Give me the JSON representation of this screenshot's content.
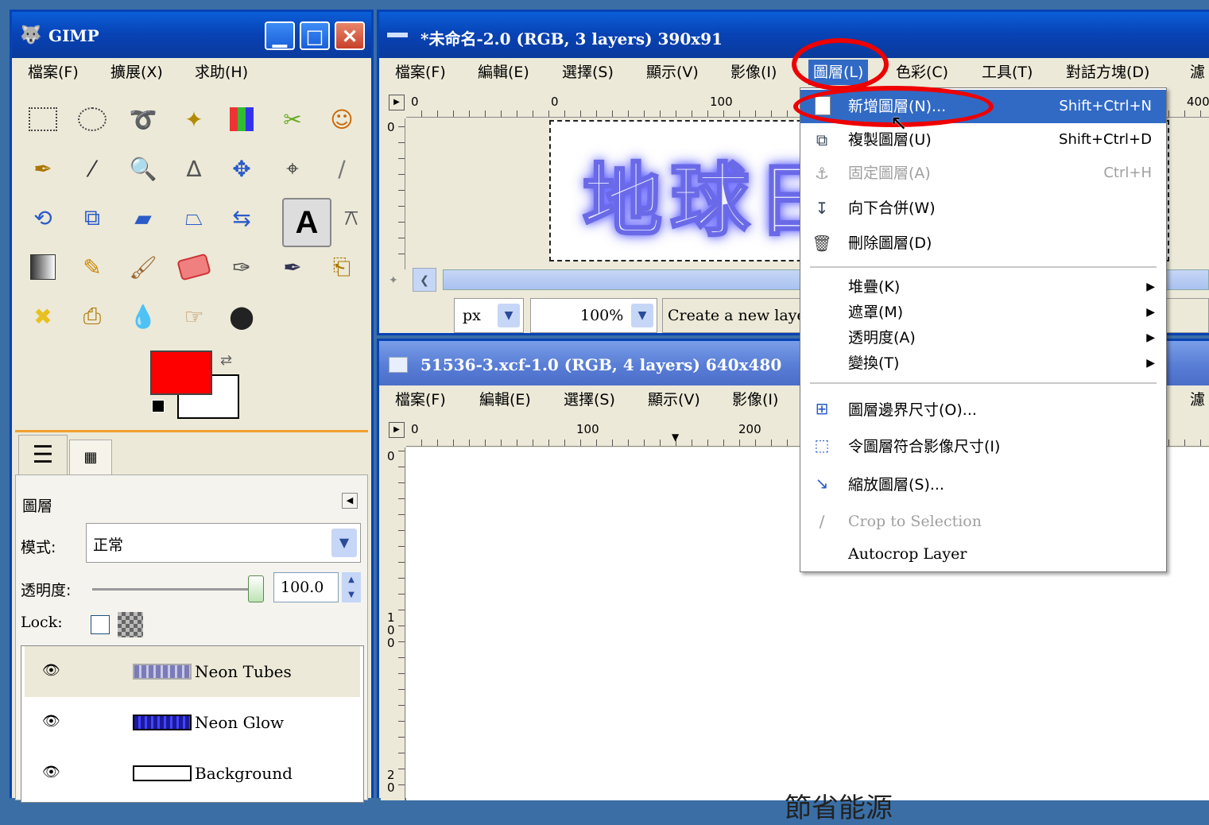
{
  "toolbox": {
    "title": "GIMP",
    "menu": [
      "檔案(F)",
      "擴展(X)",
      "求助(H)"
    ],
    "tools": [
      "rect-select-icon",
      "ellipse-select-icon",
      "lasso-icon",
      "magic-wand-icon",
      "color-select-icon",
      "scissors-icon",
      "foreground-select-icon",
      "paths-icon",
      "color-picker-icon",
      "zoom-icon",
      "measure-icon",
      "move-icon",
      "align-icon",
      "crop-icon",
      "rotate-icon",
      "scale-icon",
      "shear-icon",
      "perspective-icon",
      "flip-icon",
      "text-icon",
      "bucket-fill-icon",
      "blend-icon",
      "pencil-icon",
      "paintbrush-icon",
      "eraser-icon",
      "airbrush-icon",
      "ink-icon",
      "clone-icon",
      "heal-icon",
      "perspective-clone-icon",
      "blur-icon",
      "smudge-icon",
      "dodge-burn-icon"
    ],
    "colors": {
      "foreground": "#ff0000",
      "background": "#ffffff"
    }
  },
  "layers_dock": {
    "title": "圖層",
    "mode_label": "模式:",
    "mode_value": "正常",
    "opacity_label": "透明度:",
    "opacity_value": "100.0",
    "opacity_fraction": 1.0,
    "lock_label": "Lock:",
    "layers": [
      {
        "name": "Neon Tubes",
        "selected": true
      },
      {
        "name": "Neon Glow",
        "selected": false
      },
      {
        "name": "Background",
        "selected": false
      }
    ]
  },
  "image_window_1": {
    "title": "*未命名-2.0 (RGB, 3 layers) 390x91",
    "menu": [
      "檔案(F)",
      "編輯(E)",
      "選擇(S)",
      "顯示(V)",
      "影像(I)",
      "圖層(L)",
      "色彩(C)",
      "工具(T)",
      "對話方塊(D)",
      "濾"
    ],
    "ruler_labels": [
      "0",
      "0",
      "100",
      "400"
    ],
    "vruler_label": "0",
    "canvas_text": "地球日",
    "unit": "px",
    "zoom": "100%",
    "status": "Create a new layer"
  },
  "image_window_2": {
    "title": "51536-3.xcf-1.0 (RGB, 4 layers) 640x480",
    "menu": [
      "檔案(F)",
      "編輯(E)",
      "選擇(S)",
      "顯示(V)",
      "影像(I)",
      "濾"
    ],
    "ruler_labels": [
      "0",
      "100",
      "200"
    ],
    "vruler_labels": [
      "0",
      "100",
      "20"
    ],
    "canvas_text": "節省能源"
  },
  "layer_menu": {
    "items": [
      {
        "label": "新增圖層(N)...",
        "shortcut": "Shift+Ctrl+N",
        "icon": "new-layer-icon",
        "highlighted": true
      },
      {
        "label": "複製圖層(U)",
        "shortcut": "Shift+Ctrl+D",
        "icon": "duplicate-layer-icon"
      },
      {
        "label": "固定圖層(A)",
        "shortcut": "Ctrl+H",
        "icon": "anchor-icon",
        "disabled": true
      },
      {
        "label": "向下合併(W)",
        "shortcut": "",
        "icon": "merge-down-icon"
      },
      {
        "label": "刪除圖層(D)",
        "shortcut": "",
        "icon": "delete-layer-icon"
      },
      {
        "label": "堆疊(K)",
        "submenu": true
      },
      {
        "label": "遮罩(M)",
        "submenu": true
      },
      {
        "label": "透明度(A)",
        "submenu": true
      },
      {
        "label": "變換(T)",
        "submenu": true
      },
      {
        "label": "圖層邊界尺寸(O)...",
        "icon": "layer-boundary-icon"
      },
      {
        "label": "令圖層符合影像尺寸(I)",
        "icon": "layer-to-image-size-icon"
      },
      {
        "label": "縮放圖層(S)...",
        "icon": "scale-layer-icon"
      },
      {
        "label": "Crop to Selection",
        "icon": "crop-to-selection-icon",
        "disabled": true
      },
      {
        "label": "Autocrop Layer"
      }
    ]
  }
}
